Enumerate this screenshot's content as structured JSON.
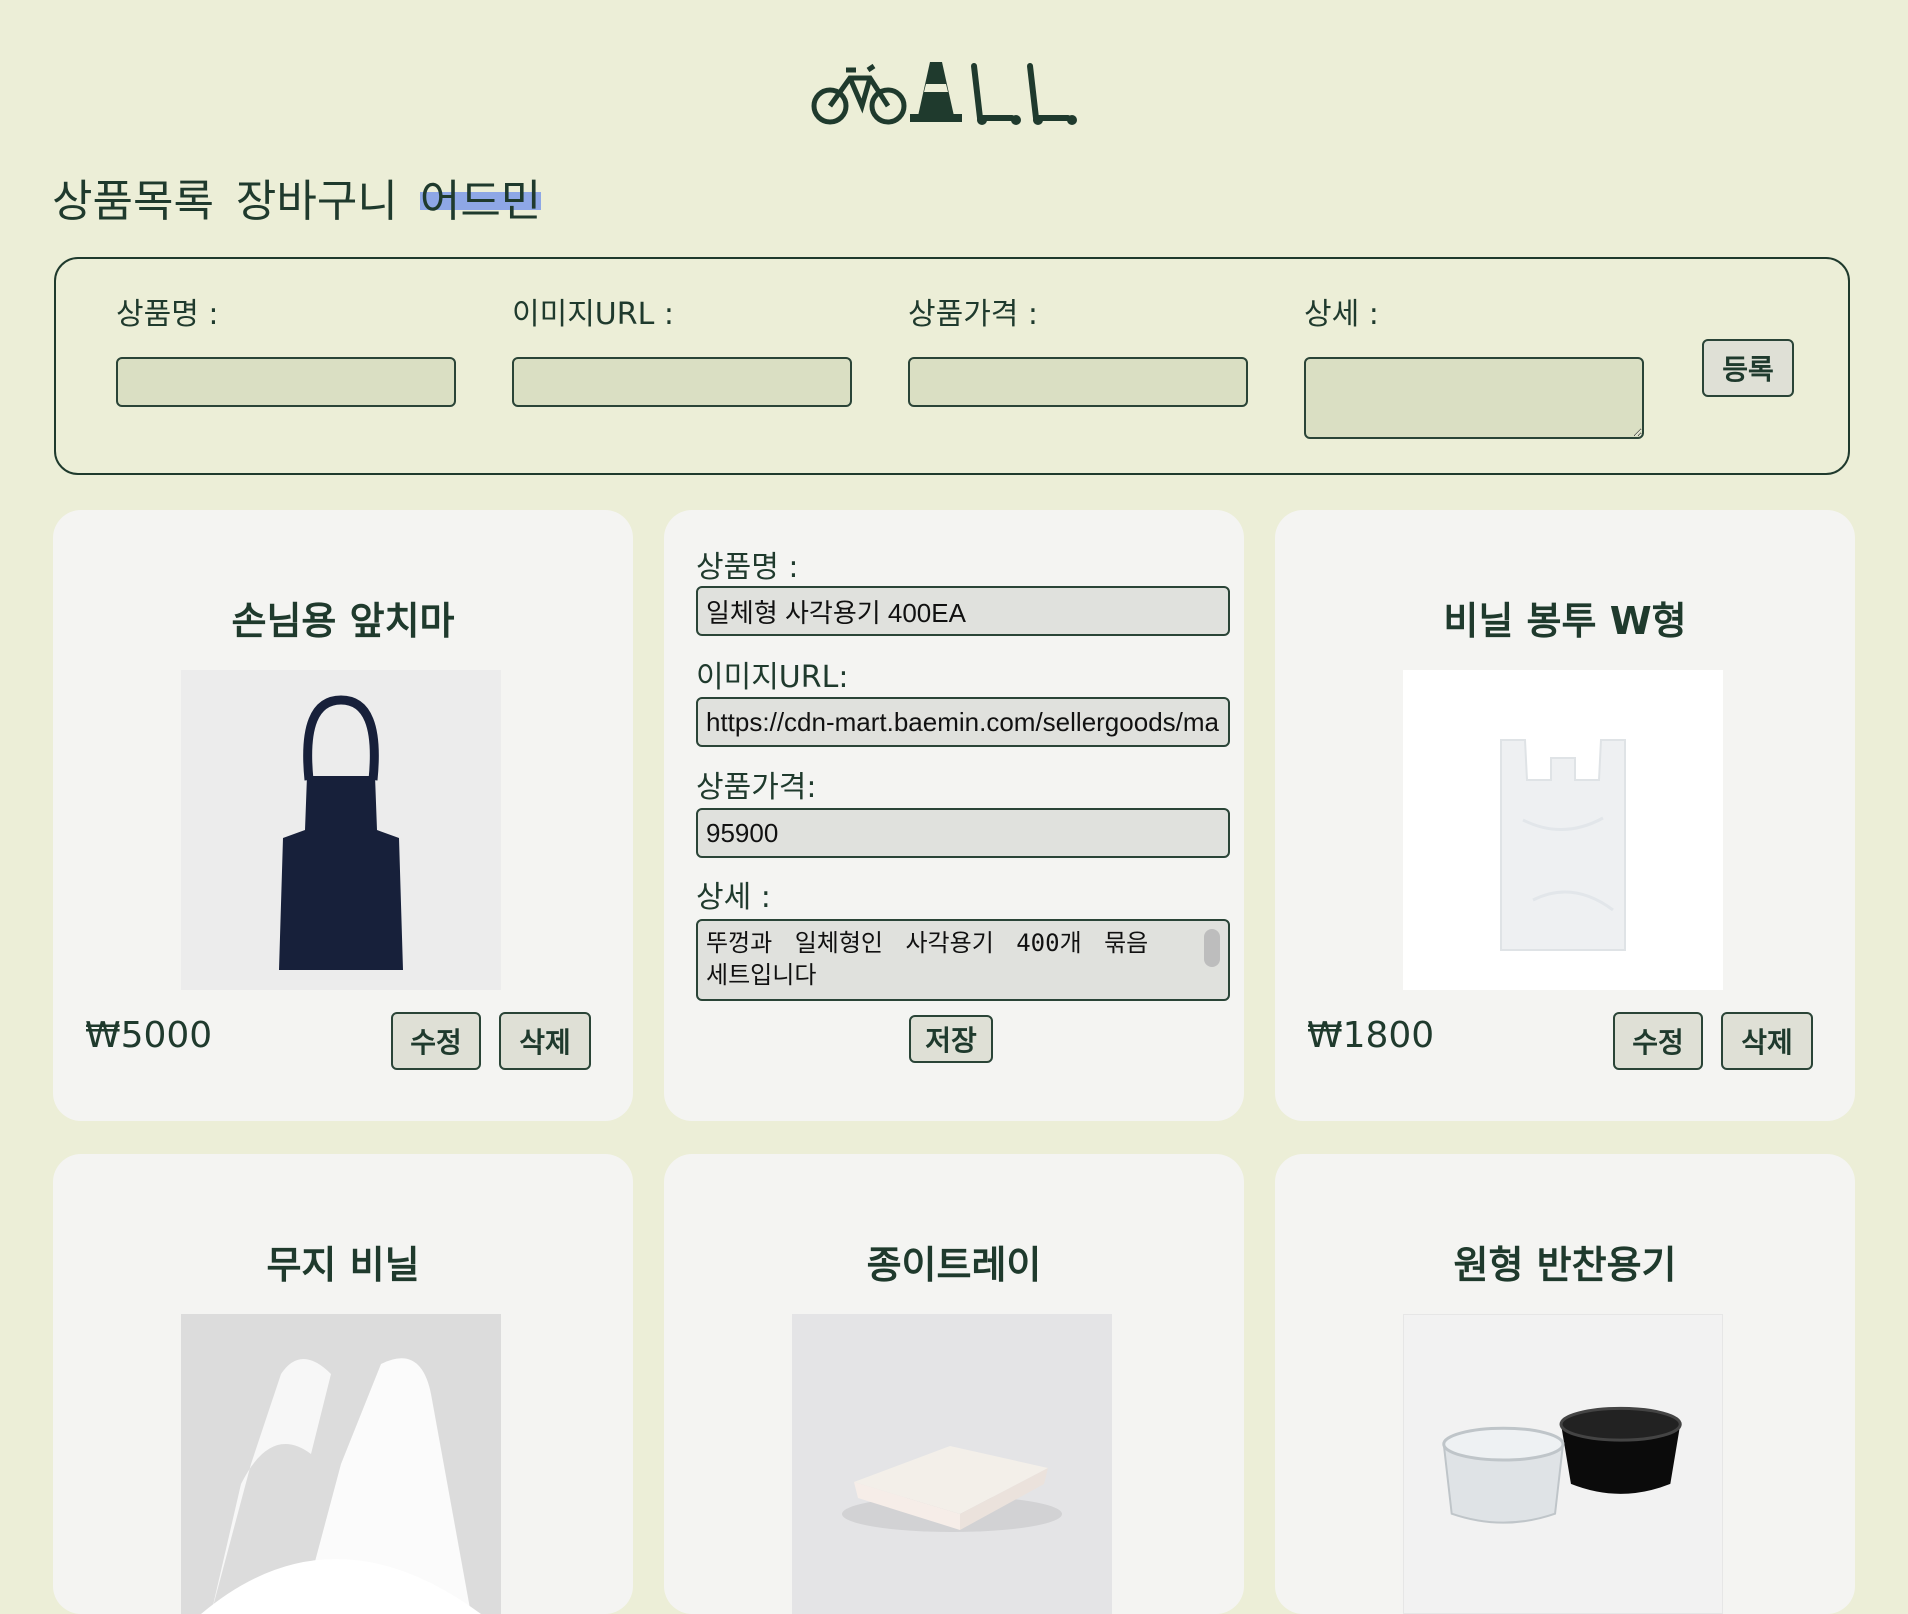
{
  "nav": {
    "items": [
      "상품목록",
      "장바구니",
      "어드민"
    ],
    "active_index": 2
  },
  "form": {
    "name_label": "상품명 :",
    "image_label": "이미지URL :",
    "price_label": "상품가격 :",
    "detail_label": "상세 :",
    "name_value": "",
    "image_value": "",
    "price_value": "",
    "detail_value": "",
    "register_button": "등록"
  },
  "products": [
    {
      "title": "손님용 앞치마",
      "price": "₩5000",
      "image": "apron-image",
      "edit_label": "수정",
      "delete_label": "삭제"
    },
    {
      "editing": true,
      "name_label": "상품명 :",
      "name_value": "일체형 사각용기 400EA",
      "image_label": "이미지URL:",
      "image_value": "https://cdn-mart.baemin.com/sellergoods/ma",
      "price_label": "상품가격:",
      "price_value": "95900",
      "detail_label": "상세 :",
      "detail_value": "뚜껑과 일체형인 사각용기 400개 묶음 세트입니다",
      "save_label": "저장"
    },
    {
      "title": "비닐 봉투 W형",
      "price": "₩1800",
      "image": "plastic-bag-image",
      "edit_label": "수정",
      "delete_label": "삭제"
    },
    {
      "title": "무지 비닐",
      "image": "white-vinyl-bag-image"
    },
    {
      "title": "종이트레이",
      "image": "paper-tray-image"
    },
    {
      "title": "원형 반찬용기",
      "image": "round-containers-image"
    }
  ],
  "colors": {
    "background": "#eceed7",
    "card": "#f4f4f2",
    "text": "#1f3a2d",
    "input": "#dadfc3",
    "highlight": "#8ea7e6"
  }
}
